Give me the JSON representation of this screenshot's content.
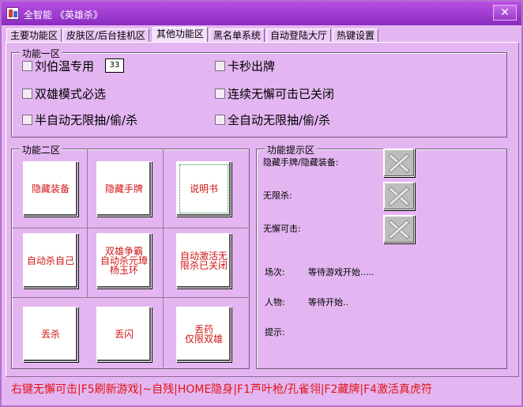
{
  "window": {
    "title": "全智能 《英雄杀》",
    "close": "✕"
  },
  "tabs": [
    {
      "label": "主要功能区"
    },
    {
      "label": "皮肤区/后台挂机区"
    },
    {
      "label": "其他功能区"
    },
    {
      "label": "黑名单系统"
    },
    {
      "label": "自动登陆大厅"
    },
    {
      "label": "热键设置"
    }
  ],
  "group1": {
    "legend": "功能一区",
    "checkboxes": [
      {
        "label": "刘伯温专用"
      },
      {
        "label": "卡秒出牌"
      },
      {
        "label": "双雄模式必选"
      },
      {
        "label": "连续无懈可击已关闭"
      },
      {
        "label": "半自动无限抽/偷/杀"
      },
      {
        "label": "全自动无限抽/偷/杀"
      }
    ],
    "number_value": "33"
  },
  "group2": {
    "legend": "功能二区",
    "buttons": [
      {
        "lines": [
          "隐藏装备"
        ]
      },
      {
        "lines": [
          "隐藏手牌"
        ]
      },
      {
        "lines": [
          "说明书"
        ]
      },
      {
        "lines": [
          "自动杀自己"
        ]
      },
      {
        "lines": [
          "双雄争霸",
          "自动杀元璋",
          "杨玉环"
        ]
      },
      {
        "lines": [
          "自动激活无",
          "限杀已关闭"
        ]
      },
      {
        "lines": [
          "丢杀"
        ]
      },
      {
        "lines": [
          "丢闪"
        ]
      },
      {
        "lines": [
          "丢药",
          "仅限双雄"
        ]
      }
    ]
  },
  "group3": {
    "legend": "功能提示区",
    "hide_cards_label": "隐藏手牌/隐藏装备:",
    "unlimited_kill_label": "无限杀:",
    "no_dodge_label": "无懈可击:",
    "match_label": "场次:",
    "match_value": "等待游戏开始.....",
    "character_label": "人物:",
    "character_value": "等待开始..",
    "hint_label": "提示:"
  },
  "footer": {
    "text": "右键无懈可击|F5刷新游戏|~自残|HOME隐身|F1芦叶枪/孔雀翎|F2藏牌|F4激活真虎符"
  },
  "colors": {
    "accent": "#d01414",
    "background": "#e4b6f1",
    "titlebar": "#9a3bc8"
  },
  "icons": {
    "status_icon": "x-icon",
    "close_icon": "close-icon"
  }
}
